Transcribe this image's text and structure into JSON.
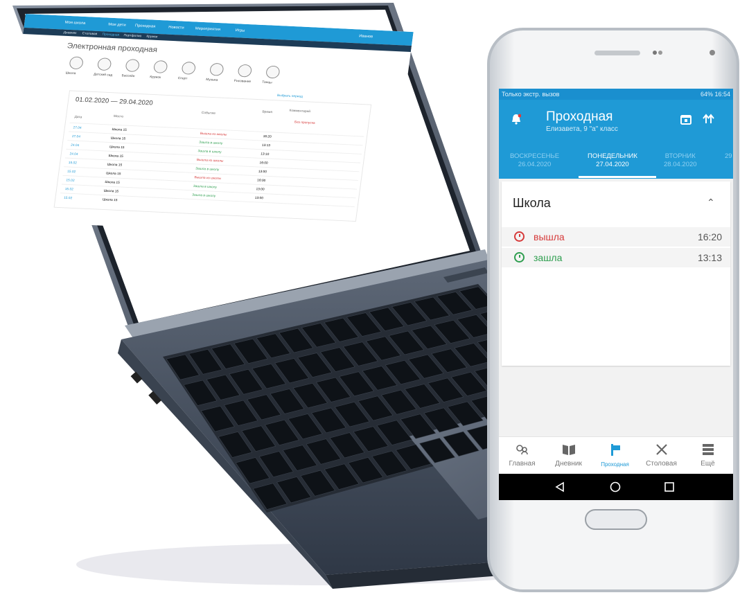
{
  "laptop": {
    "topbar": {
      "logo": "Моя школа",
      "items": [
        "Мои дети",
        "Проходная",
        "Новости",
        "Мероприятия",
        "Игры"
      ],
      "user": "Иванов"
    },
    "subnav": [
      "Дневник",
      "Столовая",
      "Проходная",
      "Портфолио",
      "Кружки"
    ],
    "page_title": "Электронная проходная",
    "avatars": [
      "Школа",
      "Детский сад",
      "Бассейн",
      "Кружок",
      "Спорт",
      "Музыка",
      "Рисование",
      "Танцы"
    ],
    "link": "Выбрать период",
    "date_range": "01.02.2020 — 29.04.2020",
    "table_headers": [
      "Дата",
      "Место",
      "Событие",
      "Время",
      "Комментарий"
    ],
    "note": "Без пропуска",
    "rows": [
      {
        "date": "27.04",
        "place": "Школа 15",
        "event": "Вышла из школы",
        "time": "16:20"
      },
      {
        "date": "27.04",
        "place": "Школа 15",
        "event": "Зашла в школу",
        "time": "13:13"
      },
      {
        "date": "24.04",
        "place": "Школа 15",
        "event": "Зашла в школу",
        "time": "13:10"
      },
      {
        "date": "24.04",
        "place": "Школа 15",
        "event": "Вышла из школы",
        "time": "16:00"
      },
      {
        "date": "15.02",
        "place": "Школа 15",
        "event": "Зашла в школу",
        "time": "13:00"
      },
      {
        "date": "15.02",
        "place": "Школа 15",
        "event": "Вышла из школы",
        "time": "16:00"
      },
      {
        "date": "15.02",
        "place": "Школа 15",
        "event": "Зашла в школу",
        "time": "13:00"
      },
      {
        "date": "15.02",
        "place": "Школа 15",
        "event": "Зашла в школу",
        "time": "13:00"
      },
      {
        "date": "15.02",
        "place": "Школа 15",
        "event": "",
        "time": ""
      }
    ]
  },
  "phone": {
    "status_left": "Только экстр. вызов",
    "status_right": "64% 16:54",
    "title": "Проходная",
    "subtitle": "Елизавета, 9 \"а\" класс",
    "tabs": [
      {
        "day": "ВОСКРЕСЕНЬЕ",
        "date": "26.04.2020"
      },
      {
        "day": "ПОНЕДЕЛЬНИК",
        "date": "27.04.2020"
      },
      {
        "day": "ВТОРНИК",
        "date": "28.04.2020"
      },
      {
        "day": "29",
        "date": ""
      }
    ],
    "section_title": "Школа",
    "events": [
      {
        "label": "вышла",
        "time": "16:20",
        "color": "#d63a3a"
      },
      {
        "label": "зашла",
        "time": "13:13",
        "color": "#2e9e4f"
      }
    ],
    "nav": [
      {
        "label": "Главная",
        "icon": "home-icon"
      },
      {
        "label": "Дневник",
        "icon": "book-icon"
      },
      {
        "label": "Проходная",
        "icon": "turnstile-icon"
      },
      {
        "label": "Столовая",
        "icon": "cutlery-icon"
      },
      {
        "label": "Ещё",
        "icon": "menu-icon"
      }
    ],
    "colors": {
      "primary": "#1f9ad6",
      "exit": "#d63a3a",
      "enter": "#2e9e4f"
    }
  }
}
